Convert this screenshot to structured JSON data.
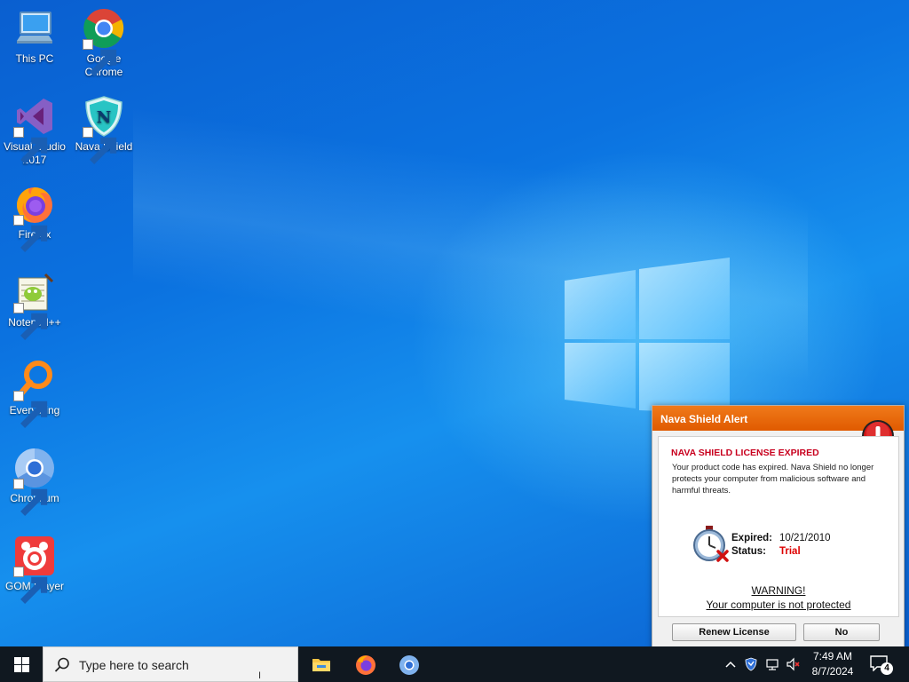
{
  "desktop_icons": [
    {
      "label": "This PC"
    },
    {
      "label": "Google\nChrome"
    },
    {
      "label": "Visual Studio\n2017"
    },
    {
      "label": "Nava Shield"
    },
    {
      "label": "Firefox"
    },
    {
      "label": "Notepad++"
    },
    {
      "label": "Everything"
    },
    {
      "label": "Chromium"
    },
    {
      "label": "GOM Player"
    }
  ],
  "alert": {
    "title": "Nava Shield Alert",
    "heading": "NAVA SHIELD LICENSE EXPIRED",
    "description": "Your product code has expired. Nava Shield no longer protects your computer from malicious software and harmful threats.",
    "expired_label": "Expired:",
    "expired_value": "10/21/2010",
    "status_label": "Status:",
    "status_value": "Trial",
    "warning": "WARNING!",
    "warning_sub": "Your computer is not protected",
    "renew_button": "Renew License",
    "no_button": "No"
  },
  "taskbar": {
    "search_placeholder": "Type here to search",
    "time": "7:49 AM",
    "date": "8/7/2024",
    "notification_count": "4",
    "pinned_apps": [
      "file-explorer-icon",
      "firefox-icon",
      "chromium-icon"
    ]
  },
  "colors": {
    "alert_title_bar": "#e86a0e",
    "alert_heading": "#c8001e",
    "status_trial": "#d00000",
    "taskbar": "#101820"
  }
}
